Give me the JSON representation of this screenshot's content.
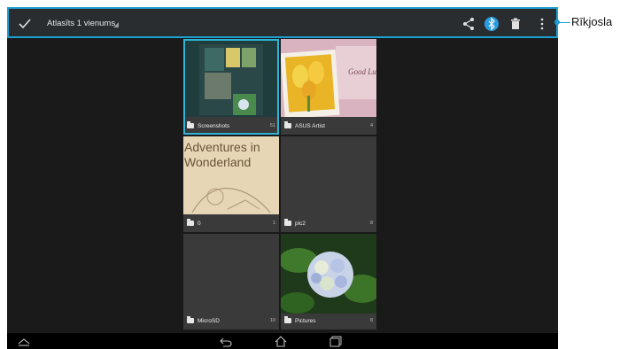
{
  "actionbar": {
    "title": "Atlasīts 1 vienums",
    "icons": [
      "check-icon",
      "share-icon",
      "bluetooth-icon",
      "trash-icon",
      "overflow-menu-icon"
    ]
  },
  "callout": {
    "label": "Rīkjosla"
  },
  "albums": [
    {
      "name": "Screenshots",
      "count": "51",
      "selected": true
    },
    {
      "name": "ASUS Artist",
      "count": "4",
      "selected": false
    },
    {
      "name": "0",
      "count": "1",
      "selected": false,
      "thumb_text": "Adventures in Wonderland"
    },
    {
      "name": "pic2",
      "count": "8",
      "selected": false
    },
    {
      "name": "MicroSD",
      "count": "10",
      "selected": false
    },
    {
      "name": "Pictures",
      "count": "8",
      "selected": false
    }
  ],
  "navbar": {
    "icons": [
      "collapse-icon",
      "back-icon",
      "home-icon",
      "recent-apps-icon"
    ]
  },
  "colors": {
    "accent": "#1f9fd0",
    "selection": "#2fb4d8",
    "bluetooth": "#2a9be0"
  }
}
